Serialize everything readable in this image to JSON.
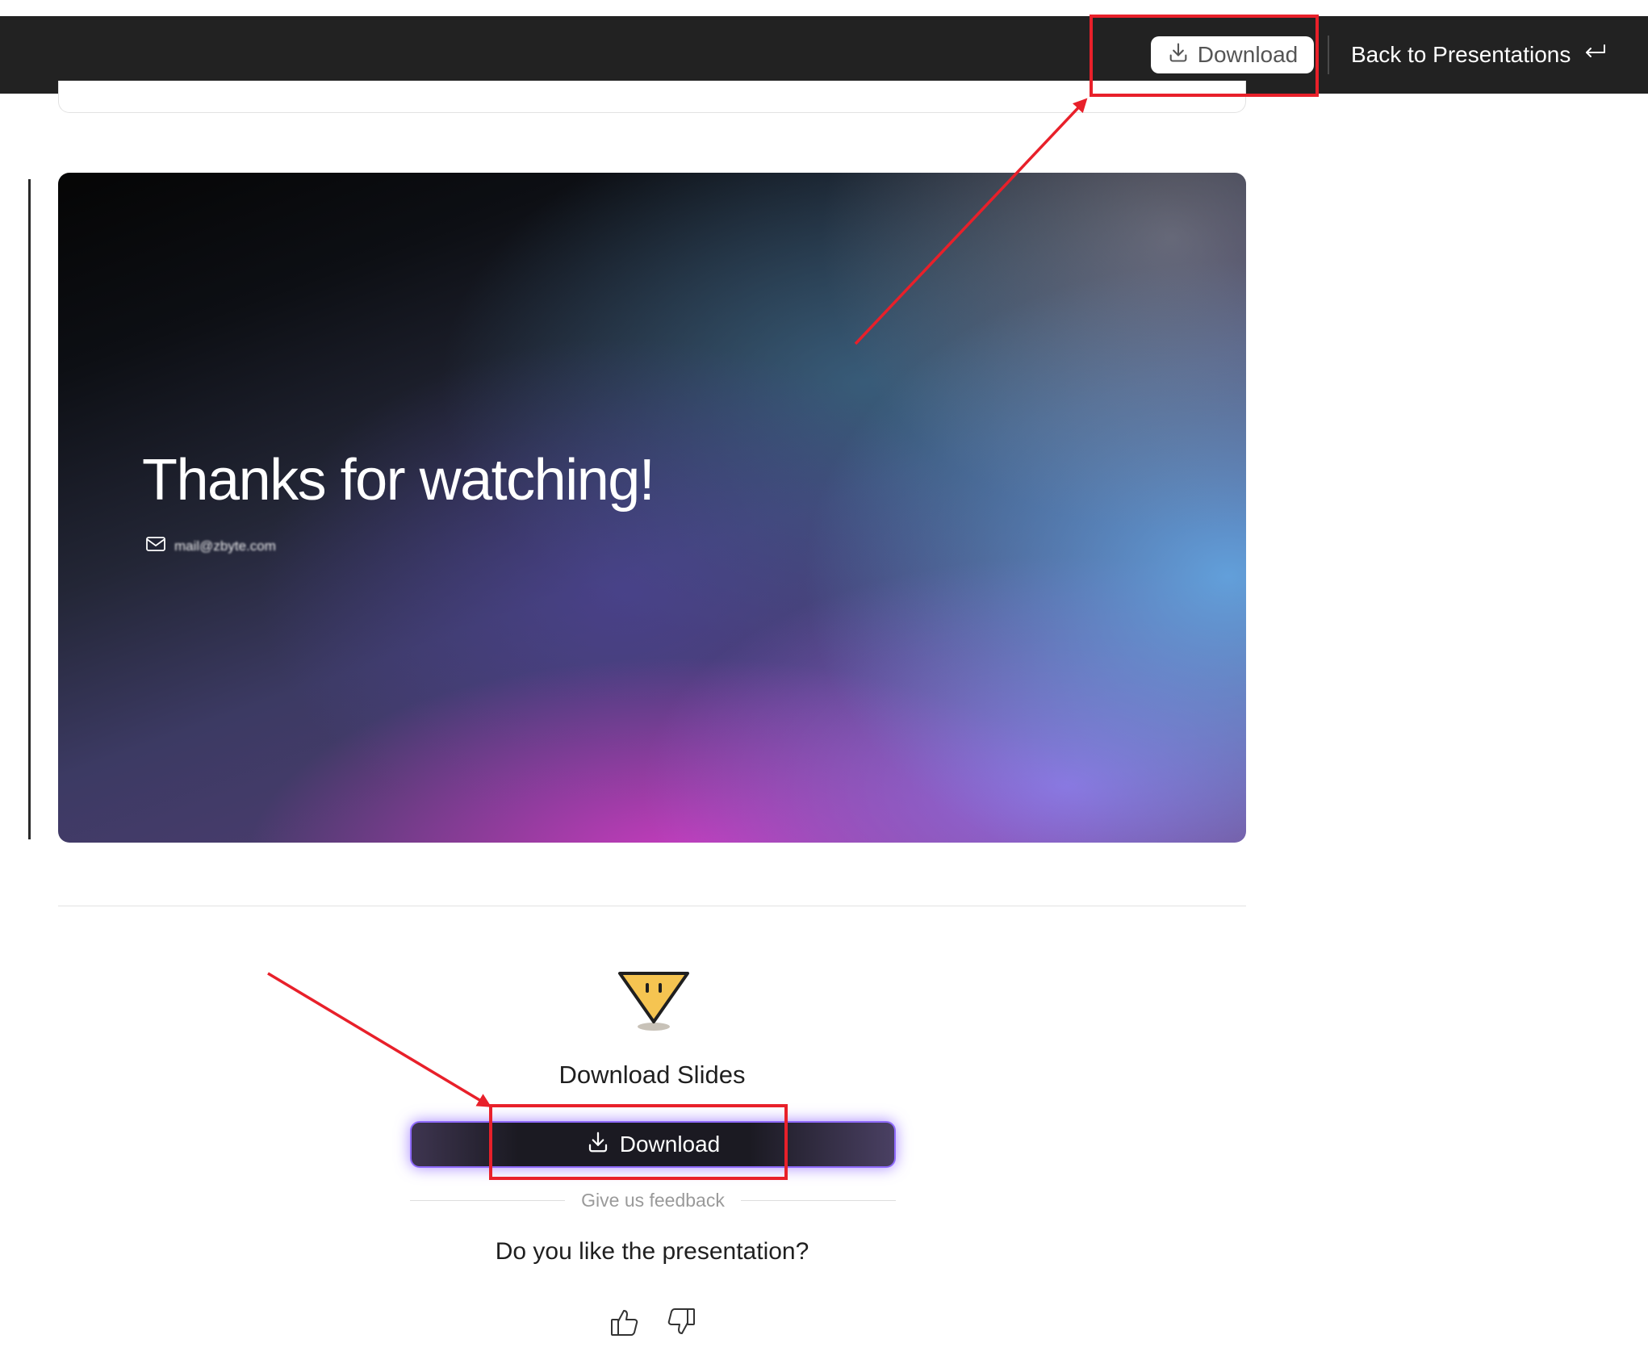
{
  "header": {
    "download_label": "Download",
    "back_label": "Back to Presentations"
  },
  "slide": {
    "title": "Thanks for watching!",
    "email": "mail@zbyte.com"
  },
  "download_section": {
    "title": "Download Slides",
    "button_label": "Download",
    "feedback_label": "Give us feedback",
    "question": "Do you like the presentation?"
  },
  "icons": {
    "download": "download-icon",
    "back": "return-arrow-icon",
    "mail": "mail-icon",
    "mascot": "mascot-icon",
    "like": "thumbs-up-icon",
    "dislike": "thumbs-down-icon"
  },
  "colors": {
    "topbar": "#222222",
    "annotation": "#e8202a",
    "button_glow": "#8f6bff"
  }
}
